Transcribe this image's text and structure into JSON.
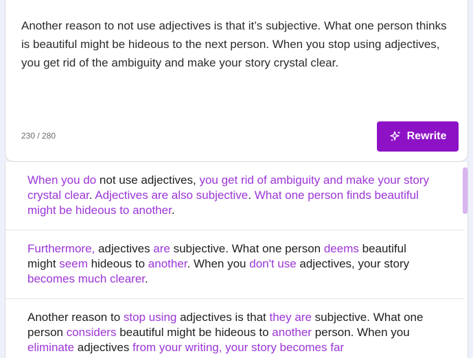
{
  "editor": {
    "text": "Another reason to not use adjectives is that it’s subjective. What one person thinks is beautiful might be hideous to the next person. When you stop using adjectives, you get rid of the ambiguity and make your story crystal clear.",
    "char_count": "230 / 280",
    "rewrite_label": "Rewrite",
    "rewrite_icon": "sparkles-icon",
    "accent_color": "#8d12c6"
  },
  "results": {
    "highlight_color": "#9b35d6",
    "items": [
      {
        "segments": [
          {
            "text": "When you do",
            "hl": true
          },
          {
            "text": " not use adjectives",
            "hl": false
          },
          {
            "text": ", ",
            "hl": false
          },
          {
            "text": "you get rid of ambiguity and make your story crystal clear",
            "hl": true
          },
          {
            "text": ". ",
            "hl": false
          },
          {
            "text": "Adjectives are also subjective",
            "hl": true
          },
          {
            "text": ". ",
            "hl": false
          },
          {
            "text": "What one person finds beautiful might be hideous to another",
            "hl": true
          },
          {
            "text": ".",
            "hl": false
          }
        ]
      },
      {
        "segments": [
          {
            "text": "Furthermore,",
            "hl": true
          },
          {
            "text": " adjectives ",
            "hl": false
          },
          {
            "text": "are",
            "hl": true
          },
          {
            "text": " subjective. What one person ",
            "hl": false
          },
          {
            "text": "deems",
            "hl": true
          },
          {
            "text": " beautiful might ",
            "hl": false
          },
          {
            "text": "seem",
            "hl": true
          },
          {
            "text": " hideous to ",
            "hl": false
          },
          {
            "text": "another",
            "hl": true
          },
          {
            "text": ". When you ",
            "hl": false
          },
          {
            "text": "don't use",
            "hl": true
          },
          {
            "text": " adjectives, your story ",
            "hl": false
          },
          {
            "text": "becomes much clearer",
            "hl": true
          },
          {
            "text": ".",
            "hl": false
          }
        ]
      },
      {
        "segments": [
          {
            "text": "Another reason to ",
            "hl": false
          },
          {
            "text": "stop using",
            "hl": true
          },
          {
            "text": " adjectives is that ",
            "hl": false
          },
          {
            "text": "they are",
            "hl": true
          },
          {
            "text": " subjective. What one person ",
            "hl": false
          },
          {
            "text": "considers",
            "hl": true
          },
          {
            "text": " beautiful might be hideous to ",
            "hl": false
          },
          {
            "text": "another",
            "hl": true
          },
          {
            "text": " person. When you ",
            "hl": false
          },
          {
            "text": "eliminate",
            "hl": true
          },
          {
            "text": " adjectives ",
            "hl": false
          },
          {
            "text": "from your writing, your story becomes far",
            "hl": true
          }
        ]
      }
    ]
  }
}
